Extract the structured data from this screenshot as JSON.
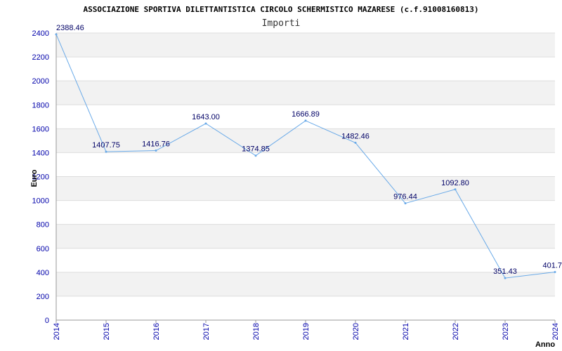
{
  "chart_data": {
    "type": "line",
    "title": "ASSOCIAZIONE SPORTIVA DILETTANTISTICA CIRCOLO SCHERMISTICO MAZARESE (c.f.91008160813)",
    "subtitle": "Importi",
    "xlabel": "Anno",
    "ylabel": "Euro",
    "ylim": [
      0,
      2400
    ],
    "yticks": [
      0,
      200,
      400,
      600,
      800,
      1000,
      1200,
      1400,
      1600,
      1800,
      2000,
      2200,
      2400
    ],
    "grid": true,
    "x": [
      "2014",
      "2015",
      "2016",
      "2017",
      "2018",
      "2019",
      "2020",
      "2021",
      "2022",
      "2023",
      "2024"
    ],
    "series": [
      {
        "values": [
          2388.46,
          1407.75,
          1416.76,
          1643.0,
          1374.85,
          1666.89,
          1482.46,
          976.44,
          1092.8,
          351.43,
          401.7
        ],
        "labels": [
          "2388.46",
          "1407.75",
          "1416.76",
          "1643.00",
          "1374.85",
          "1666.89",
          "1482.46",
          "976.44",
          "1092.80",
          "351.43",
          "401.7"
        ]
      }
    ],
    "colors": {
      "line": "#6aaae8",
      "band": "#f2f2f2",
      "grid": "#dddddd",
      "tick": "#0000aa",
      "label": "#000066"
    }
  }
}
